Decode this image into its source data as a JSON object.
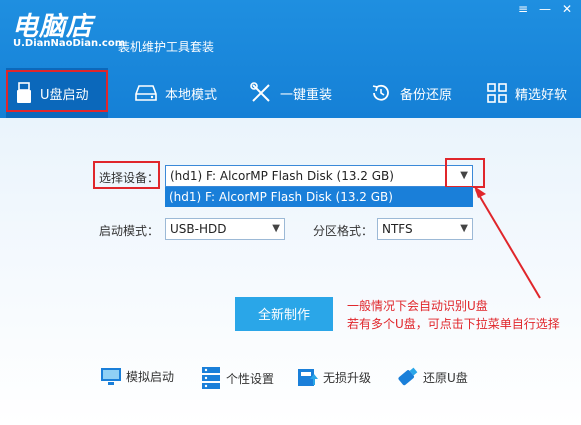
{
  "app": {
    "logo_main": "电脑店",
    "logo_sub": "U.DianNaoDian.com",
    "subtitle": "装机维护工具套装"
  },
  "window_controls": {
    "menu": "≡",
    "minimize": "—",
    "close": "✕"
  },
  "nav": {
    "items": [
      {
        "label": "U盘启动",
        "icon": "usb-icon",
        "active": true
      },
      {
        "label": "本地模式",
        "icon": "hard-drive-icon"
      },
      {
        "label": "一键重装",
        "icon": "tools-icon"
      },
      {
        "label": "备份还原",
        "icon": "restore-icon"
      },
      {
        "label": "精选好软",
        "icon": "grid-icon"
      }
    ]
  },
  "form": {
    "device_label": "选择设备：",
    "device_value": "(hd1) F: AlcorMP Flash Disk (13.2 GB)",
    "device_options": [
      "(hd1) F: AlcorMP Flash Disk (13.2 GB)"
    ],
    "boot_label": "启动模式：",
    "boot_value": "USB-HDD",
    "partition_label": "分区格式：",
    "partition_value": "NTFS",
    "create_button": "全新制作"
  },
  "annotation": {
    "line1": "一般情况下会自动识别U盘",
    "line2": "若有多个U盘，可点击下拉菜单自行选择",
    "color": "#e0262b"
  },
  "tools": [
    {
      "label": "模拟启动",
      "icon": "monitor-icon"
    },
    {
      "label": "个性设置",
      "icon": "server-icon"
    },
    {
      "label": "无损升级",
      "icon": "upgrade-icon"
    },
    {
      "label": "还原U盘",
      "icon": "usb-stick-icon"
    }
  ]
}
